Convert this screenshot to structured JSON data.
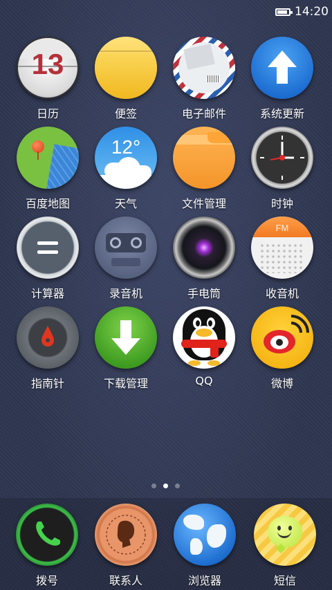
{
  "status_bar": {
    "time": "14:20",
    "battery_level": 0.85
  },
  "apps": [
    {
      "label": "日历",
      "icon": "calendar-icon",
      "badge": "13"
    },
    {
      "label": "便签",
      "icon": "notes-icon"
    },
    {
      "label": "电子邮件",
      "icon": "email-icon"
    },
    {
      "label": "系统更新",
      "icon": "system-update-icon"
    },
    {
      "label": "百度地图",
      "icon": "map-icon"
    },
    {
      "label": "天气",
      "icon": "weather-icon",
      "temp": "12°"
    },
    {
      "label": "文件管理",
      "icon": "folder-icon"
    },
    {
      "label": "时钟",
      "icon": "clock-icon"
    },
    {
      "label": "计算器",
      "icon": "calculator-icon"
    },
    {
      "label": "录音机",
      "icon": "recorder-icon"
    },
    {
      "label": "手电筒",
      "icon": "flashlight-icon"
    },
    {
      "label": "收音机",
      "icon": "radio-icon",
      "badge": "FM"
    },
    {
      "label": "指南针",
      "icon": "compass-icon"
    },
    {
      "label": "下载管理",
      "icon": "download-icon"
    },
    {
      "label": "QQ",
      "icon": "qq-penguin-icon"
    },
    {
      "label": "微博",
      "icon": "weibo-icon"
    }
  ],
  "page_indicator": {
    "pages": 3,
    "current": 2
  },
  "dock": [
    {
      "label": "拨号",
      "icon": "phone-icon"
    },
    {
      "label": "联系人",
      "icon": "contacts-icon"
    },
    {
      "label": "浏览器",
      "icon": "browser-globe-icon"
    },
    {
      "label": "短信",
      "icon": "sms-icon"
    }
  ]
}
